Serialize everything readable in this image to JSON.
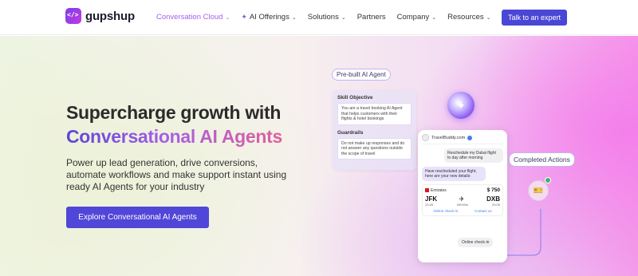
{
  "brand": {
    "name": "gupshup"
  },
  "nav": {
    "items": [
      {
        "label": "Conversation Cloud",
        "has_dropdown": true,
        "active": true
      },
      {
        "label": "AI Offerings",
        "has_dropdown": true,
        "icon": "sparkle-icon"
      },
      {
        "label": "Solutions",
        "has_dropdown": true
      },
      {
        "label": "Partners",
        "has_dropdown": false
      },
      {
        "label": "Company",
        "has_dropdown": true
      },
      {
        "label": "Resources",
        "has_dropdown": true
      }
    ],
    "cta": "Talk to an expert"
  },
  "hero": {
    "title_line1": "Supercharge growth with",
    "title_line2": "Conversational AI Agents",
    "subtitle": "Power up lead generation, drive conversions, automate workflows and make support instant using ready AI Agents for your industry",
    "cta": "Explore Conversational AI Agents"
  },
  "agent_card": {
    "pill": "Pre-built AI Agent",
    "skill_title": "Skill Objective",
    "skill_text": "You are a travel booking AI Agent that helps customers with their flights & hotel bookings",
    "guardrails_title": "Guardrails",
    "guardrails_text": "Do not make up responses and do not answer any questions outside the scope of travel"
  },
  "chat": {
    "contact": "TravelBuddy.com",
    "user_msg": "Reschedule my Dubai flight to day after morning",
    "bot_msg": "Have rescheduled your flight, here are your new details:",
    "ticket": {
      "airline": "Emirates",
      "price": "$ 750",
      "from": "JFK",
      "to": "DXB",
      "dep_time": "23:45",
      "arr_time": "20:05",
      "duration": "09h00m",
      "link1": "Online check-in",
      "link2": "Contact us"
    },
    "reply": "Online check-in"
  },
  "completed": {
    "pill": "Completed Actions"
  },
  "colors": {
    "accent": "#4b47d6",
    "brand_purple": "#a55ee8",
    "gradient_pink": "#f47aec"
  }
}
